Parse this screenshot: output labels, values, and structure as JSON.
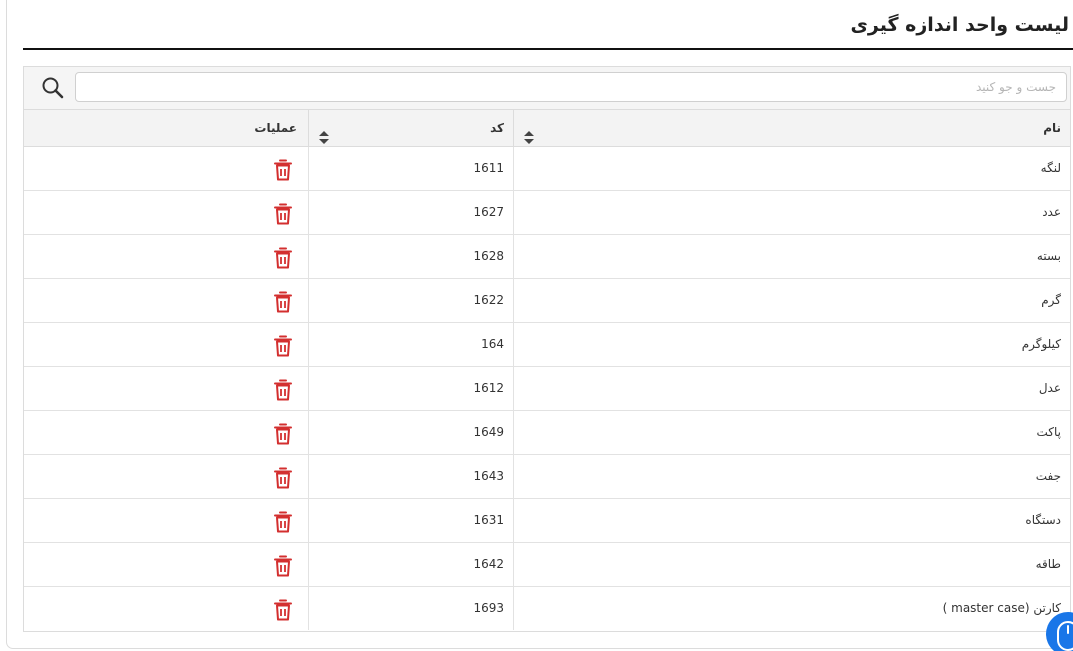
{
  "page": {
    "title": "لیست واحد اندازه گیری"
  },
  "search": {
    "placeholder": "جست و جو کنید",
    "value": ""
  },
  "table": {
    "columns": {
      "name": "نام",
      "code": "کد",
      "operations": "عملیات"
    },
    "rows": [
      {
        "name": "لنگه",
        "code": "1611"
      },
      {
        "name": "عدد",
        "code": "1627"
      },
      {
        "name": "بسته",
        "code": "1628"
      },
      {
        "name": "گرم",
        "code": "1622"
      },
      {
        "name": "کیلوگرم",
        "code": "164"
      },
      {
        "name": "عدل",
        "code": "1612"
      },
      {
        "name": "پاکت",
        "code": "1649"
      },
      {
        "name": "جفت",
        "code": "1643"
      },
      {
        "name": "دستگاه",
        "code": "1631"
      },
      {
        "name": "طاقه",
        "code": "1642"
      },
      {
        "name": "کارتن (master case )",
        "code": "1693"
      }
    ]
  },
  "icons": {
    "search": "search-icon",
    "sort": "sort-icon",
    "delete": "trash-icon",
    "fab": "mouse-icon"
  },
  "colors": {
    "delete": "#d32f2f",
    "fab": "#1976e8",
    "title_rule": "#111111"
  }
}
